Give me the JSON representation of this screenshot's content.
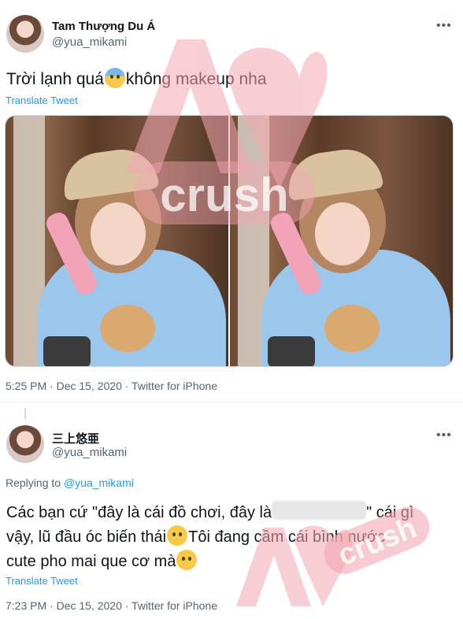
{
  "tweet1": {
    "name": "Tam Thượng Du Á",
    "handle": "@yua_mikami",
    "more": "•••",
    "text_before": "Trời lạnh quá",
    "text_after": "không makeup nha",
    "translate": "Translate Tweet",
    "meta": "5:25 PM · Dec 15, 2020 · Twitter for iPhone"
  },
  "tweet2": {
    "name": "三上悠亜",
    "handle": "@yua_mikami",
    "more": "•••",
    "reply_prefix": "Replying to ",
    "reply_handle": "@yua_mikami",
    "line1_a": "Các bạn cứ \"đây là cái đồ chơi, đây là",
    "line1_b": "\" cái gì",
    "line2_a": "vậy, lũ đầu óc biến thái",
    "line2_b": "Tôi đang cầm cái bình nước",
    "line3": "cute pho mai que cơ mà",
    "translate": "Translate Tweet",
    "meta": "7:23 PM · Dec 15, 2020 · Twitter for iPhone"
  },
  "watermark": {
    "text": "crush",
    "brand": "AV"
  },
  "colors": {
    "link": "#1d9bf0",
    "muted": "#536471",
    "watermark": "#f4a7b3"
  }
}
